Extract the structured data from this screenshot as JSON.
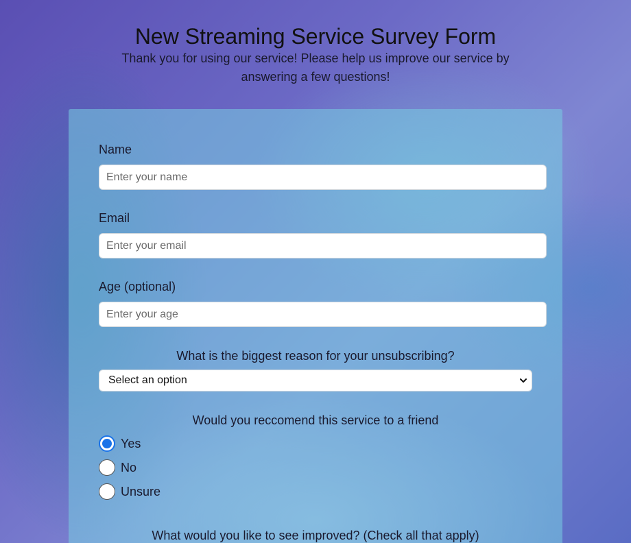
{
  "header": {
    "title": "New Streaming Service Survey Form",
    "description": "Thank you for using our service! Please help us improve our service by answering a few questions!"
  },
  "form": {
    "name": {
      "label": "Name",
      "placeholder": "Enter your name"
    },
    "email": {
      "label": "Email",
      "placeholder": "Enter your email"
    },
    "age": {
      "label": "Age (optional)",
      "placeholder": "Enter your age"
    },
    "reason": {
      "question": "What is the biggest reason for your unsubscribing?",
      "selected": "Select an option"
    },
    "recommend": {
      "question": "Would you reccomend this service to a friend",
      "options": [
        {
          "label": "Yes",
          "checked": true
        },
        {
          "label": "No",
          "checked": false
        },
        {
          "label": "Unsure",
          "checked": false
        }
      ]
    },
    "improve": {
      "question": "What would you like to see improved? (Check all that apply)"
    }
  },
  "colors": {
    "accent": "#1a73e8"
  }
}
